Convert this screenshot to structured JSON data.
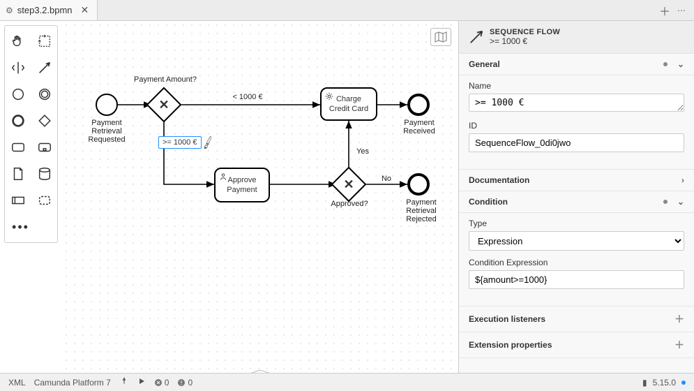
{
  "tab": {
    "filename": "step3.2.bpmn"
  },
  "palette_tools": [
    "hand",
    "lasso",
    "space",
    "connect",
    "start-event",
    "intermediate-event",
    "end-event",
    "gateway",
    "task",
    "subprocess",
    "data-object",
    "data-store",
    "participant",
    "group",
    "more"
  ],
  "diagram": {
    "elements": {
      "start_event": {
        "label": "Payment Retrieval Requested"
      },
      "gateway_amount": {
        "label": "Payment Amount?"
      },
      "gateway_approved": {
        "label": "Approved?"
      },
      "task_approve": {
        "label": "Approve Payment"
      },
      "task_charge": {
        "label": "Charge Credit Card"
      },
      "end_received": {
        "label": "Payment Received"
      },
      "end_rejected": {
        "label": "Payment Retrieval Rejected"
      }
    },
    "flows": {
      "lt1000": {
        "label": "< 1000 €"
      },
      "gte1000": {
        "label": ">= 1000 €"
      },
      "yes": {
        "label": "Yes"
      },
      "no": {
        "label": "No"
      }
    }
  },
  "properties": {
    "header_type": "SEQUENCE FLOW",
    "header_name": ">= 1000 €",
    "sections": {
      "general": {
        "title": "General",
        "name_label": "Name",
        "name_value": ">= 1000 €",
        "id_label": "ID",
        "id_value": "SequenceFlow_0di0jwo"
      },
      "documentation": {
        "title": "Documentation"
      },
      "condition": {
        "title": "Condition",
        "type_label": "Type",
        "type_value": "Expression",
        "expr_label": "Condition Expression",
        "expr_value": "${amount>=1000}"
      },
      "execution_listeners": {
        "title": "Execution listeners"
      },
      "extension_properties": {
        "title": "Extension properties"
      }
    }
  },
  "statusbar": {
    "xml": "XML",
    "platform": "Camunda Platform 7",
    "errors": "0",
    "warnings": "0",
    "version": "5.15.0"
  }
}
